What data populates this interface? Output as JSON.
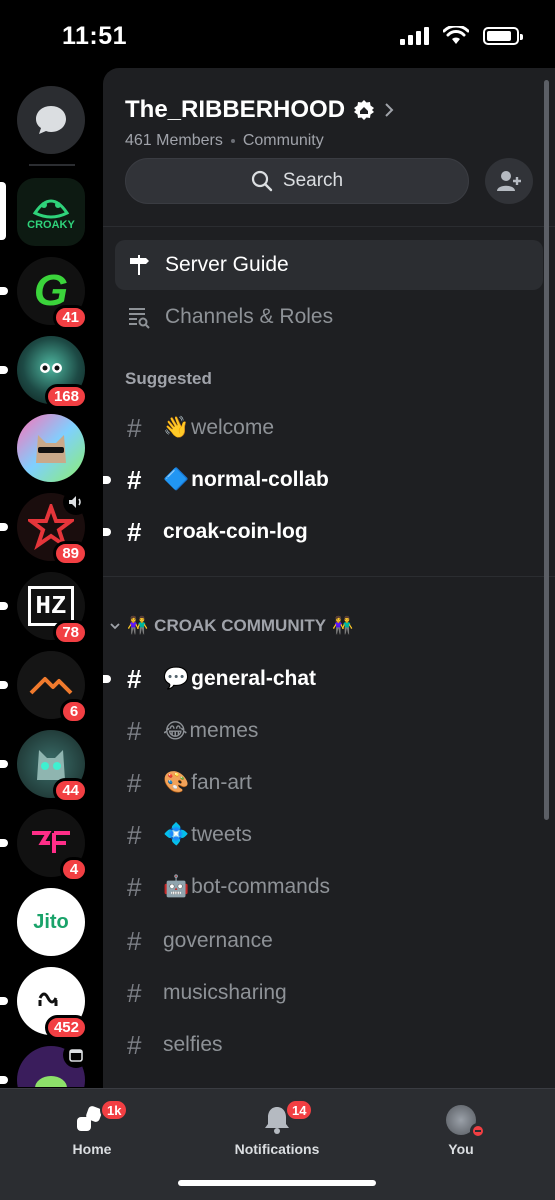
{
  "status_bar": {
    "time": "11:51"
  },
  "server": {
    "name": "The_RIBBERHOOD",
    "members": "461 Members",
    "type": "Community",
    "search_label": "Search"
  },
  "nav": {
    "server_guide": "Server Guide",
    "channels_roles": "Channels & Roles",
    "suggested_label": "Suggested"
  },
  "suggested_channels": [
    {
      "emoji": "👋",
      "name": "welcome"
    },
    {
      "emoji": "🔷",
      "name": "normal-collab"
    },
    {
      "emoji": "",
      "name": "croak-coin-log"
    }
  ],
  "category": {
    "emoji_left": "👫",
    "name": "CROAK COMMUNITY",
    "emoji_right": "👫"
  },
  "channels": [
    {
      "emoji": "💬",
      "name": "general-chat"
    },
    {
      "emoji": "😂",
      "name": "memes"
    },
    {
      "emoji": "🎨",
      "name": "fan-art"
    },
    {
      "emoji": "💠",
      "name": "tweets"
    },
    {
      "emoji": "🤖",
      "name": "bot-commands"
    },
    {
      "emoji": "",
      "name": "governance"
    },
    {
      "emoji": "",
      "name": "musicsharing"
    },
    {
      "emoji": "",
      "name": "selfies"
    }
  ],
  "guilds": [
    {
      "label": "CROAKY",
      "badge": ""
    },
    {
      "label": "G",
      "badge": "41"
    },
    {
      "label": "",
      "badge": "168"
    },
    {
      "label": "",
      "badge": ""
    },
    {
      "label": "",
      "badge": "89"
    },
    {
      "label": "HZ",
      "badge": "78"
    },
    {
      "label": "",
      "badge": "6"
    },
    {
      "label": "",
      "badge": "44"
    },
    {
      "label": "",
      "badge": "4"
    },
    {
      "label": "Jito",
      "badge": ""
    },
    {
      "label": "",
      "badge": "452"
    },
    {
      "label": "",
      "badge": ""
    }
  ],
  "tabs": {
    "home": {
      "label": "Home",
      "badge": "1k"
    },
    "notifications": {
      "label": "Notifications",
      "badge": "14"
    },
    "you": {
      "label": "You"
    }
  },
  "colors": {
    "accent_red": "#f23f43",
    "panel_bg": "#1e1f22",
    "rail_bg": "#000000"
  }
}
